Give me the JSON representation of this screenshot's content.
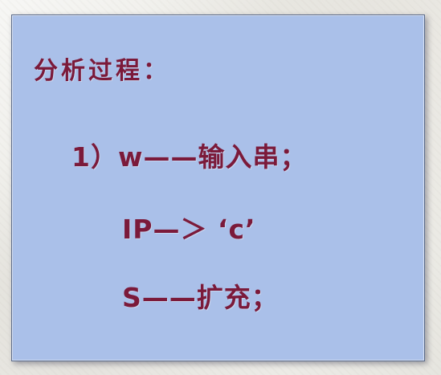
{
  "slide": {
    "heading": "分析过程：",
    "lines": [
      "1）w——输入串；",
      "IP—＞ ‘c’",
      "S——扩充；"
    ]
  }
}
